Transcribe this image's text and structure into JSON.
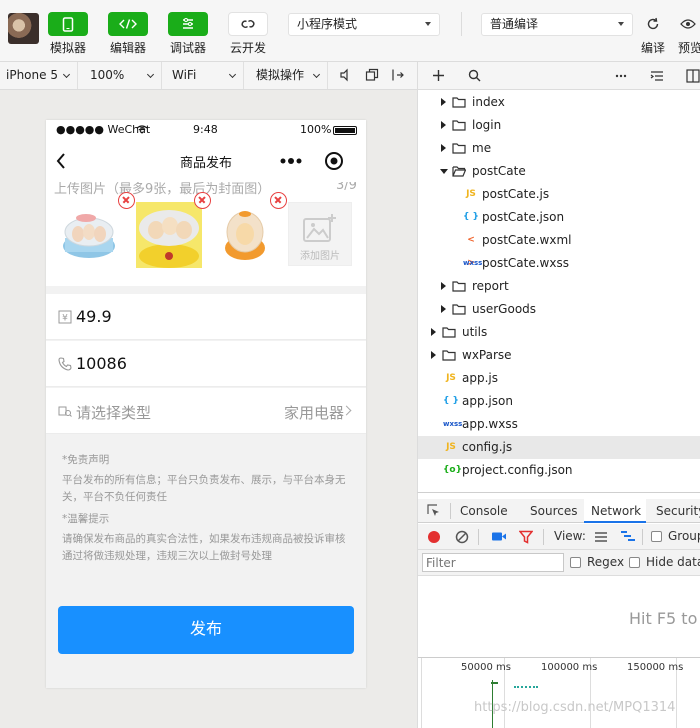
{
  "toolbar": {
    "simulator": "模拟器",
    "editor": "编辑器",
    "debugger": "调试器",
    "cloud": "云开发",
    "mode": "小程序模式",
    "compile": "普通编译",
    "compile_btn": "编译",
    "preview_btn": "预览"
  },
  "simbar": {
    "device": "iPhone 5",
    "zoom": "100%",
    "network": "WiFi",
    "operation": "模拟操作"
  },
  "phone": {
    "status": {
      "carrier": "●●●●● WeChat",
      "time": "9:48",
      "battery": "100%"
    },
    "nav_title": "商品发布",
    "upload_title_cut": "上传图片（最多9张，最后为封面图）",
    "upload_count_cut": "3/9",
    "add_image": "添加图片",
    "price": "49.9",
    "phone_number": "10086",
    "type_placeholder": "请选择类型",
    "type_value": "家用电器",
    "disclaimer_title": "*免责声明",
    "disclaimer_text": "平台发布的所有信息；平台只负责发布、展示，与平台本身无关，平台不负任何责任",
    "tip_title": "*温馨提示",
    "tip_text": "请确保发布商品的真实合法性，如果发布违规商品被投诉审核通过将做违规处理，违规三次以上做封号处理",
    "publish": "发布"
  },
  "tree": {
    "items": [
      {
        "name": "index",
        "type": "folder"
      },
      {
        "name": "login",
        "type": "folder"
      },
      {
        "name": "me",
        "type": "folder"
      },
      {
        "name": "postCate",
        "type": "folder-open"
      },
      {
        "name": "postCate.js",
        "type": "js"
      },
      {
        "name": "postCate.json",
        "type": "json"
      },
      {
        "name": "postCate.wxml",
        "type": "wxml"
      },
      {
        "name": "postCate.wxss",
        "type": "wxss"
      },
      {
        "name": "report",
        "type": "folder"
      },
      {
        "name": "userGoods",
        "type": "folder"
      },
      {
        "name": "utils",
        "type": "folder"
      },
      {
        "name": "wxParse",
        "type": "folder"
      },
      {
        "name": "app.js",
        "type": "js"
      },
      {
        "name": "app.json",
        "type": "json"
      },
      {
        "name": "app.wxss",
        "type": "wxss"
      },
      {
        "name": "config.js",
        "type": "js"
      },
      {
        "name": "project.config.json",
        "type": "config"
      }
    ],
    "selected": "config.js"
  },
  "devtools": {
    "tabs": [
      "Console",
      "Sources",
      "Network",
      "Security"
    ],
    "active_tab": "Network",
    "view_label": "View:",
    "group_label": "Group",
    "filter_placeholder": "Filter",
    "regex_label": "Regex",
    "hide_data_label": "Hide data",
    "hint": "Hit F5 to",
    "ticks": [
      "50000 ms",
      "100000 ms",
      "150000 ms"
    ]
  },
  "watermark": "https://blog.csdn.net/MPQ1314",
  "colors": {
    "accent_green": "#1aad19",
    "publish_blue": "#1890ff",
    "delete_red": "#e84141",
    "devtools_blue": "#1a73e8"
  }
}
